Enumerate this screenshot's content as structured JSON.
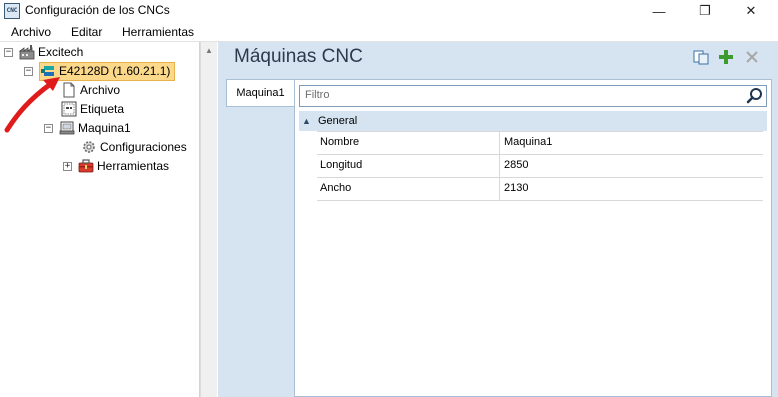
{
  "window": {
    "title": "Configuración de los CNCs",
    "icon_text": "CNC",
    "controls": {
      "minimize": "—",
      "maximize": "❐",
      "close": "✕"
    }
  },
  "menu": {
    "items": [
      {
        "label": "Archivo"
      },
      {
        "label": "Editar"
      },
      {
        "label": "Herramientas"
      }
    ]
  },
  "tree": {
    "root": {
      "label": "Excitech",
      "expander": "−"
    },
    "cnc": {
      "label": "E42128D (1.60.21.1)",
      "expander": "−"
    },
    "archivo": {
      "label": "Archivo"
    },
    "etiqueta": {
      "label": "Etiqueta"
    },
    "maquina": {
      "label": "Maquina1",
      "expander": "−"
    },
    "configuraciones": {
      "label": "Configuraciones"
    },
    "herramientas": {
      "label": "Herramientas",
      "expander": "+"
    }
  },
  "main": {
    "title": "Máquinas CNC",
    "tab_label": "Maquina1",
    "filter_placeholder": "Filtro",
    "group_label": "General",
    "properties": [
      {
        "name": "Nombre",
        "value": "Maquina1"
      },
      {
        "name": "Longitud",
        "value": "2850"
      },
      {
        "name": "Ancho",
        "value": "2130"
      }
    ]
  },
  "colors": {
    "selection": "#fbd88a",
    "panel_background": "#d6e4f2",
    "annotation_arrow": "#e01b1b"
  },
  "icons": [
    "factory-icon",
    "cnc-device-icon",
    "file-icon",
    "label-icon",
    "machine-icon",
    "gear-icon",
    "toolbox-icon",
    "copy-icon",
    "add-icon",
    "delete-icon",
    "search-icon"
  ]
}
